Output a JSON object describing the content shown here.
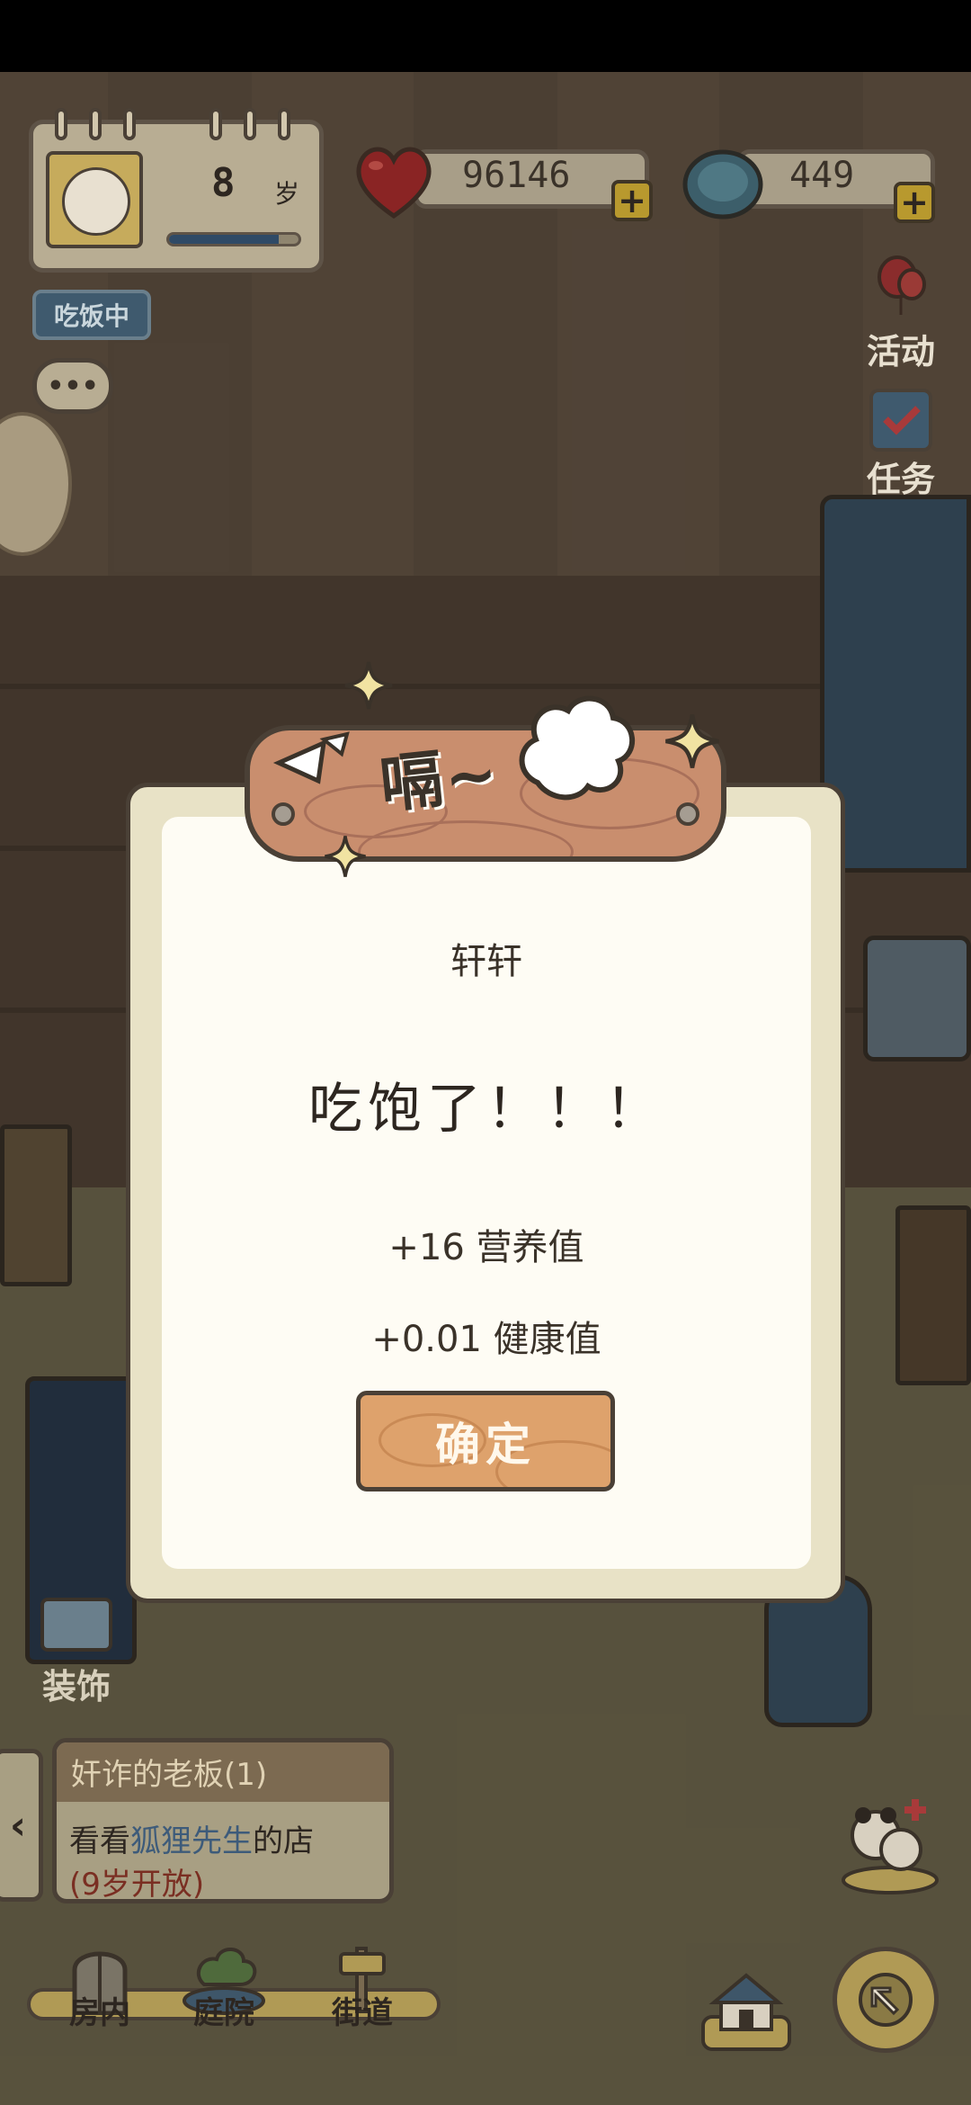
{
  "profile": {
    "age": "8",
    "age_unit": "岁",
    "age_progress": 0.85,
    "state": "吃饭中",
    "chat": "•••"
  },
  "currency": {
    "hearts": "96146",
    "coins": "449",
    "plus": "+"
  },
  "side": {
    "activity": "活动",
    "tasks": "任务"
  },
  "dialog": {
    "banner": "嗝~",
    "pet_name": "轩轩",
    "message": "吃饱了！！！",
    "reward_nutrition": "+16 营养值",
    "reward_health": "+0.01 健康值",
    "confirm": "确定"
  },
  "bottom": {
    "decorate": "装饰",
    "quest": {
      "title": "奸诈的老板(1)",
      "line_prefix": "看看",
      "line_highlight": "狐狸先生",
      "line_suffix": "的店",
      "line2": "(9岁开放)",
      "arrow": "‹"
    },
    "nav": {
      "room": "房内",
      "yard": "庭院",
      "street": "街道"
    }
  },
  "colors": {
    "wood": "#dea26c",
    "plank": "#c98e6e",
    "paper": "#fefcf4",
    "dim_bg": "#4a4036"
  }
}
